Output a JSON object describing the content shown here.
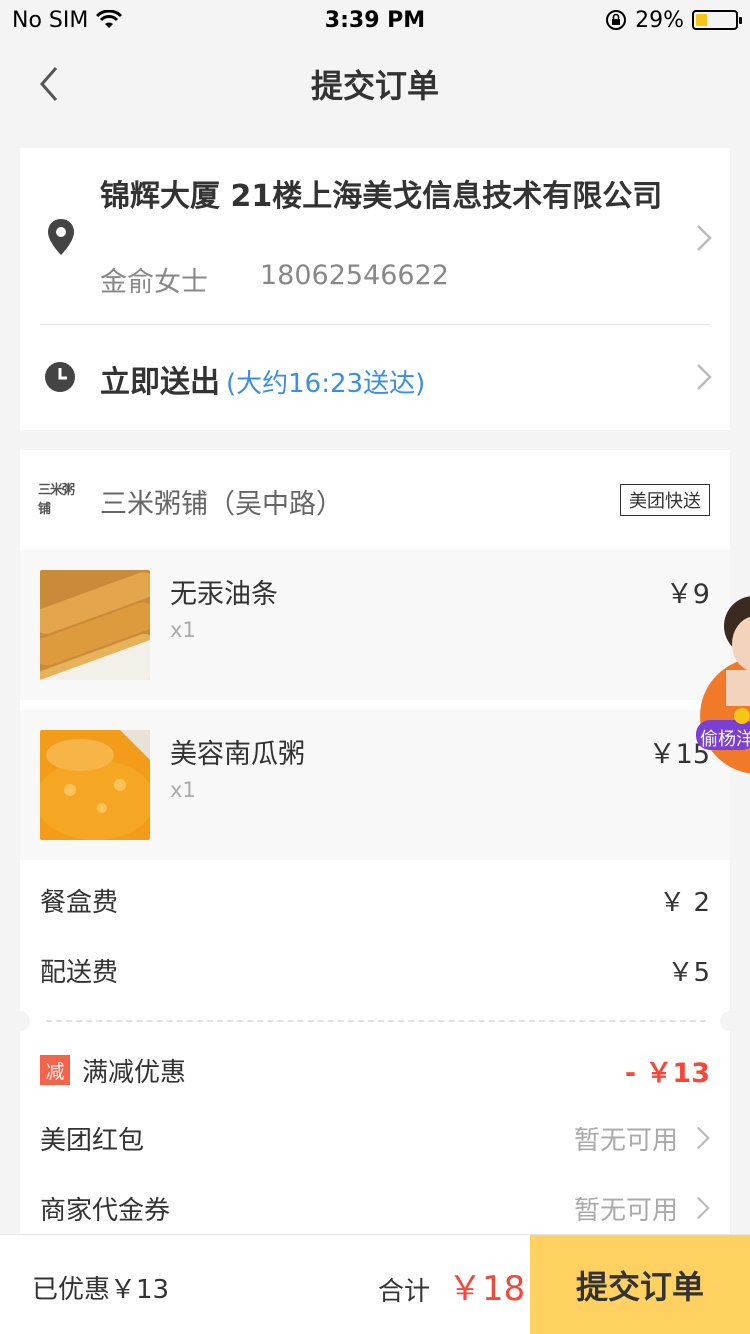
{
  "status_bar": {
    "carrier": "No SIM",
    "time": "3:39 PM",
    "battery": "29%",
    "battery_level": 0.29
  },
  "nav": {
    "title": "提交订单"
  },
  "address": {
    "line": "锦辉大厦 21楼上海美戈信息技术有限公司",
    "name": "金俞女士",
    "phone": "18062546622"
  },
  "delivery": {
    "label": "立即送出",
    "eta": "(大约16:23送达)"
  },
  "shop": {
    "logo_text": "三米粥铺",
    "name": "三米粥铺（吴中路）",
    "badge": "美团快送"
  },
  "items": [
    {
      "name": "无汞油条",
      "qty": "x1",
      "price": "￥9"
    },
    {
      "name": "美容南瓜粥",
      "qty": "x1",
      "price": "￥15"
    }
  ],
  "fees": [
    {
      "label": "餐盒费",
      "value": "￥ 2"
    },
    {
      "label": "配送费",
      "value": "￥5"
    }
  ],
  "discount": {
    "icon_text": "减",
    "label": "满减优惠",
    "value": "- ￥13"
  },
  "options": [
    {
      "label": "美团红包",
      "value": "暂无可用"
    },
    {
      "label": "商家代金券",
      "value": "暂无可用"
    }
  ],
  "floater": {
    "text": "偷杨洋"
  },
  "bottom": {
    "saved": "已优惠￥13",
    "total_label": "合计",
    "total_value": "￥18",
    "submit": "提交订单"
  },
  "colors": {
    "accent": "#ffd161",
    "price_red": "#f4493a",
    "eta_blue": "#3b8ee6"
  }
}
